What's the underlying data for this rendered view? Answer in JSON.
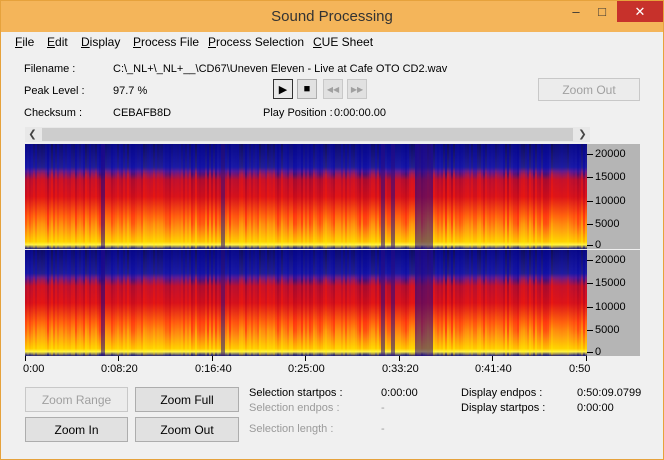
{
  "window": {
    "title": "Sound Processing",
    "controls": {
      "minimize": "–",
      "maximize": "□",
      "close": "✕"
    }
  },
  "menu": [
    "File",
    "Edit",
    "Display",
    "Process File",
    "Process Selection",
    "CUE Sheet"
  ],
  "info": {
    "filename_label": "Filename :",
    "filename_value": "C:\\_NL+\\_NL+__\\CD67\\Uneven Eleven - Live at Cafe OTO CD2.wav",
    "peak_label": "Peak Level :",
    "peak_value": "97.7 %",
    "checksum_label": "Checksum :",
    "checksum_value": "CEBAFB8D",
    "play_label": "Play Position :",
    "play_value": "0:00:00.00"
  },
  "transport": {
    "play": "▶",
    "stop": "■",
    "rewind": "◀◀",
    "forward": "▶▶"
  },
  "zoom_out_top": "Zoom Out",
  "freq_ticks": [
    "20000",
    "15000",
    "10000",
    "5000",
    "0"
  ],
  "time_ticks": [
    "0:00",
    "0:08:20",
    "0:16:40",
    "0:25:00",
    "0:33:20",
    "0:41:40",
    "0:50"
  ],
  "buttons": {
    "zoom_range": "Zoom Range",
    "zoom_full": "Zoom Full",
    "zoom_in": "Zoom In",
    "zoom_out": "Zoom Out"
  },
  "selection": {
    "start_label": "Selection startpos :",
    "start_value": "0:00:00",
    "end_label": "Selection endpos :",
    "end_value": "-",
    "length_label": "Selection length :",
    "length_value": "-"
  },
  "display": {
    "end_label": "Display endpos :",
    "end_value": "0:50:09.0799",
    "start_label": "Display startpos :",
    "start_value": "0:00:00"
  },
  "colors": {
    "titlebar": "#f4b55a",
    "close_button": "#c7312b",
    "spectrum_low": "#0a0a8a",
    "spectrum_mid": "#d8121c",
    "spectrum_high": "#ffd000"
  }
}
